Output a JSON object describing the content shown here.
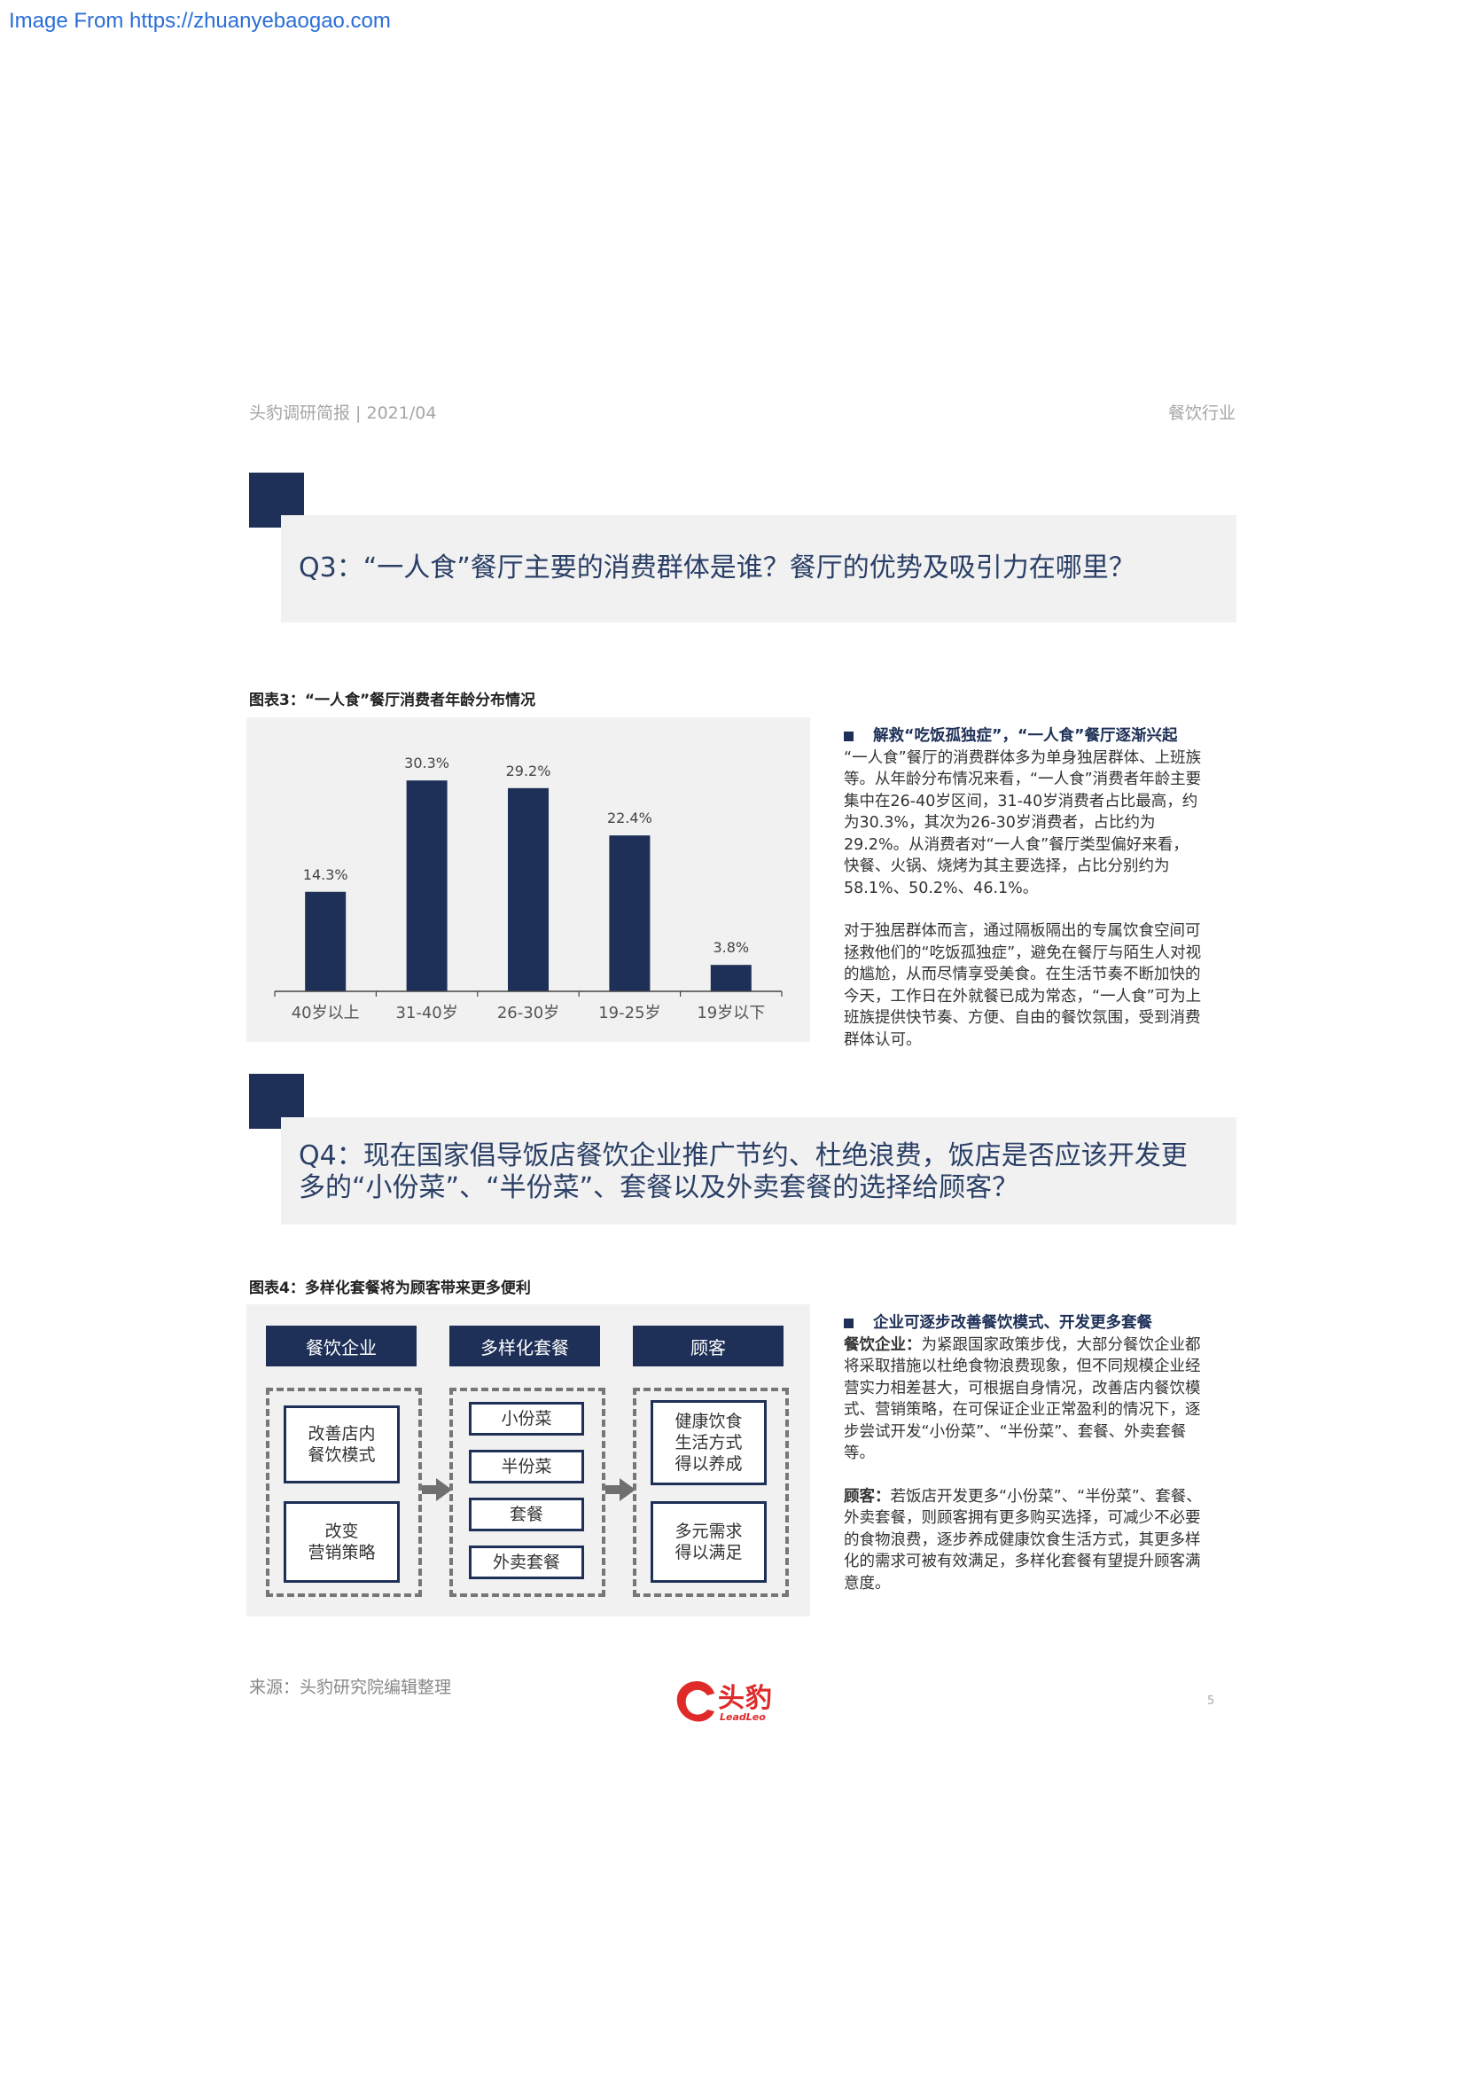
{
  "source_link": "Image From https://zhuanyebaogao.com",
  "header": {
    "left": "头豹调研简报 | 2021/04",
    "right": "餐饮行业"
  },
  "q3": {
    "title": "Q3：“一人食”餐厅主要的消费群体是谁？餐厅的优势及吸引力在哪里？"
  },
  "figure3": {
    "title": "图表3：“一人食”餐厅消费者年龄分布情况"
  },
  "chart_data": {
    "type": "bar",
    "categories": [
      "40岁以上",
      "31-40岁",
      "26-30岁",
      "19-25岁",
      "19岁以下"
    ],
    "values": [
      14.3,
      30.3,
      29.2,
      22.4,
      3.8
    ],
    "labels": [
      "14.3%",
      "30.3%",
      "29.2%",
      "22.4%",
      "3.8%"
    ],
    "ylim": [
      0,
      33
    ],
    "bar_color": "#1e3057",
    "title": "",
    "xlabel": "",
    "ylabel": ""
  },
  "sidebar3": {
    "heading": "解救“吃饭孤独症”，“一人食”餐厅逐渐兴起",
    "p1": "“一人食”餐厅的消费群体多为单身独居群体、上班族等。从年龄分布情况来看，“一人食”消费者年龄主要集中在26-40岁区间，31-40岁消费者占比最高，约为30.3%，其次为26-30岁消费者，占比约为29.2%。从消费者对“一人食”餐厅类型偏好来看，快餐、火锅、烧烤为其主要选择，占比分别约为58.1%、50.2%、46.1%。",
    "p2": "对于独居群体而言，通过隔板隔出的专属饮食空间可拯救他们的“吃饭孤独症”，避免在餐厅与陌生人对视的尴尬，从而尽情享受美食。在生活节奏不断加快的今天，工作日在外就餐已成为常态，“一人食”可为上班族提供快节奏、方便、自由的餐饮氛围，受到消费群体认可。"
  },
  "q4": {
    "title_line1": "Q4：现在国家倡导饭店餐饮企业推广节约、杜绝浪费，饭店是否应该开发更",
    "title_line2": "多的“小份菜”、“半份菜”、套餐以及外卖套餐的选择给顾客？"
  },
  "figure4": {
    "title": "图表4：多样化套餐将为顾客带来更多便利",
    "col1": {
      "header": "餐饮企业",
      "items": [
        [
          "改善店内",
          "餐饮模式"
        ],
        [
          "改变",
          "营销策略"
        ]
      ]
    },
    "col2": {
      "header": "多样化套餐",
      "items": [
        "小份菜",
        "半份菜",
        "套餐",
        "外卖套餐"
      ]
    },
    "col3": {
      "header": "顾客",
      "items": [
        [
          "健康饮食",
          "生活方式",
          "得以养成"
        ],
        [
          "多元需求",
          "得以满足"
        ]
      ]
    }
  },
  "sidebar4": {
    "heading": "企业可逐步改善餐饮模式、开发更多套餐",
    "p1_label": "餐饮企业：",
    "p1": "为紧跟国家政策步伐，大部分餐饮企业都将采取措施以杜绝食物浪费现象，但不同规模企业经营实力相差甚大，可根据自身情况，改善店内餐饮模式、营销策略，在可保证企业正常盈利的情况下，逐步尝试开发“小份菜”、“半份菜”、套餐、外卖套餐等。",
    "p2_label": "顾客：",
    "p2": "若饭店开发更多“小份菜”、“半份菜”、套餐、外卖套餐，则顾客拥有更多购买选择，可减少不必要的食物浪费，逐步养成健康饮食生活方式，其更多样化的需求可被有效满足，多样化套餐有望提升顾客满意度。"
  },
  "footer": {
    "source": "来源：头豹研究院编辑整理",
    "page": "5",
    "logo_cn": "头豹",
    "logo_en": "LeadLeo"
  }
}
